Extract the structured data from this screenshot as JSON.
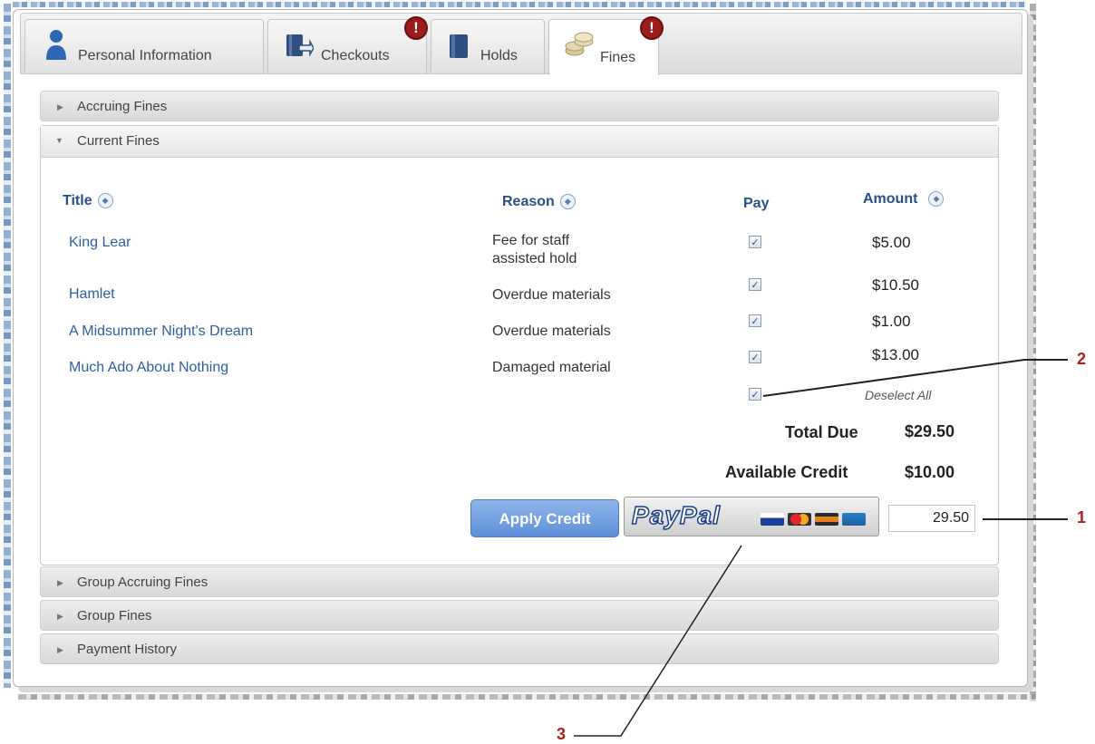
{
  "tabs": [
    {
      "label": "Personal Information",
      "icon": "person-icon",
      "alert": false
    },
    {
      "label": "Checkouts",
      "icon": "checkout-book-icon",
      "alert": true
    },
    {
      "label": "Holds",
      "icon": "book-icon",
      "alert": false
    },
    {
      "label": "Fines",
      "icon": "coins-icon",
      "alert": true,
      "active": true
    }
  ],
  "alert_glyph": "!",
  "sections": {
    "accruing": "Accruing Fines",
    "current": "Current Fines",
    "group_accruing": "Group Accruing Fines",
    "group_fines": "Group Fines",
    "payment_history": "Payment History"
  },
  "table": {
    "headers": {
      "title": "Title",
      "reason": "Reason",
      "pay": "Pay",
      "amount": "Amount"
    },
    "rows": [
      {
        "title": "King Lear",
        "reason": "Fee for staff assisted hold",
        "amount": "$5.00",
        "checked": true
      },
      {
        "title": "Hamlet",
        "reason": "Overdue materials",
        "amount": "$10.50",
        "checked": true
      },
      {
        "title": "A Midsummer Night's Dream",
        "reason": "Overdue materials",
        "amount": "$1.00",
        "checked": true
      },
      {
        "title": "Much Ado About Nothing",
        "reason": "Damaged material",
        "amount": "$13.00",
        "checked": true
      }
    ],
    "deselect_all": "Deselect All"
  },
  "summary": {
    "total_due_label": "Total Due",
    "total_due": "$29.50",
    "available_credit_label": "Available Credit",
    "available_credit": "$10.00"
  },
  "actions": {
    "apply_credit": "Apply Credit",
    "paypal": "PayPal",
    "payment_amount": "29.50"
  },
  "callouts": [
    "1",
    "2",
    "3"
  ],
  "colors": {
    "accent": "#5d8fd8",
    "link": "#2f5e9e",
    "alert": "#9b1c1c",
    "callout": "#b11e1e"
  }
}
